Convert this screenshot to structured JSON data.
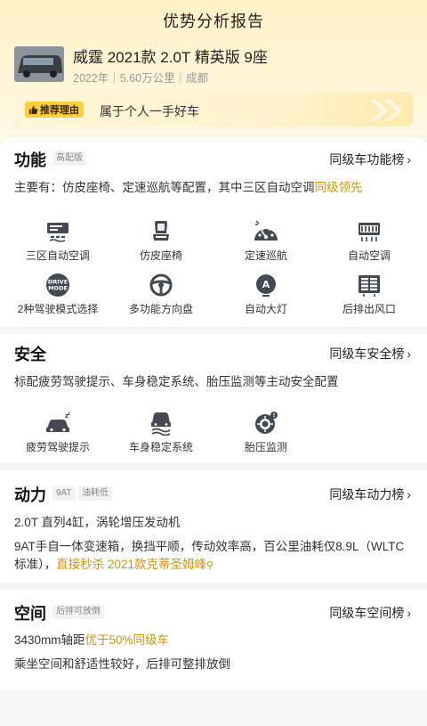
{
  "header": {
    "title": "优势分析报告"
  },
  "car": {
    "name": "威霆 2021款 2.0T 精英版 9座",
    "meta": "2022年｜5.60万公里｜成都"
  },
  "reason": {
    "tag": "推荐理由",
    "text": "属于个人一手好车"
  },
  "function": {
    "title": "功能",
    "tag": "高配版",
    "rank": "同级车功能榜",
    "desc_main": "主要有：仿皮座椅、定速巡航等配置，其中三区自动空调",
    "desc_hl": "同级领先",
    "items": [
      {
        "label": "三区自动空调",
        "icon": "climate-icon"
      },
      {
        "label": "仿皮座椅",
        "icon": "seat-icon"
      },
      {
        "label": "定速巡航",
        "icon": "cruise-icon"
      },
      {
        "label": "自动空调",
        "icon": "ac-icon"
      },
      {
        "label": "2种驾驶模式选择",
        "icon": "drive-mode-icon"
      },
      {
        "label": "多功能方向盘",
        "icon": "steering-wheel-icon"
      },
      {
        "label": "自动大灯",
        "icon": "auto-light-icon"
      },
      {
        "label": "后排出风口",
        "icon": "rear-vent-icon"
      }
    ]
  },
  "safety": {
    "title": "安全",
    "rank": "同级车安全榜",
    "desc": "标配疲劳驾驶提示、车身稳定系统、胎压监测等主动安全配置",
    "items": [
      {
        "label": "疲劳驾驶提示",
        "icon": "fatigue-icon"
      },
      {
        "label": "车身稳定系统",
        "icon": "esp-icon"
      },
      {
        "label": "胎压监测",
        "icon": "tire-pressure-icon"
      }
    ]
  },
  "power": {
    "title": "动力",
    "tags": [
      "9AT",
      "油耗低"
    ],
    "rank": "同级车动力榜",
    "line1": "2.0T 直列4缸，涡轮增压发动机",
    "line2": "9AT手自一体变速箱，换挡平顺，传动效率高，百公里油耗仅8.9L（WLTC",
    "line3": "标准），",
    "line3_hl": "直接秒杀 2021款克蒂圣姆峰"
  },
  "space": {
    "title": "空间",
    "tag": "后排可放倒",
    "rank": "同级车空间榜",
    "line1": "3430mm轴距",
    "line1_hl": "优于50%同级车",
    "line2": "乘坐空间和舒适性较好，后排可整排放倒"
  },
  "colors": {
    "accent": "#c8960a",
    "tag_yellow": "#ffcf3a"
  }
}
